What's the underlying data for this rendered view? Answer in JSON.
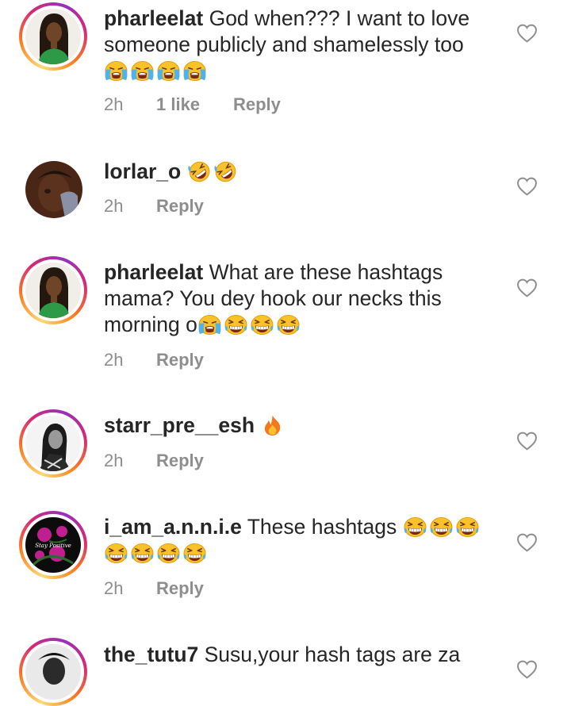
{
  "comments": [
    {
      "username": "pharleelat",
      "text": "God when??? I want to love someone publicly and shamelessly too",
      "emojis": [
        "loudly-crying-face-emoji",
        "loudly-crying-face-emoji",
        "loudly-crying-face-emoji",
        "loudly-crying-face-emoji"
      ],
      "time": "2h",
      "likes": "1 like",
      "reply_label": "Reply"
    },
    {
      "username": "lorlar_o",
      "text": "",
      "emojis": [
        "rolling-on-floor-laughing-emoji",
        "rolling-on-floor-laughing-emoji"
      ],
      "time": "2h",
      "reply_label": "Reply"
    },
    {
      "username": "pharleelat",
      "text": "What are these hashtags mama? You dey hook our necks this morning o",
      "emojis": [
        "loudly-crying-face-emoji",
        "grinning-squinting-face-emoji",
        "grinning-squinting-face-emoji",
        "grinning-squinting-face-emoji"
      ],
      "time": "2h",
      "reply_label": "Reply"
    },
    {
      "username": "starr_pre__esh",
      "text": "",
      "emojis": [
        "fire-emoji"
      ],
      "time": "2h",
      "reply_label": "Reply"
    },
    {
      "username": "i_am_a.n.n.i.e",
      "text": "These hashtags",
      "emojis": [
        "grinning-squinting-face-emoji",
        "grinning-squinting-face-emoji",
        "grinning-squinting-face-emoji",
        "grinning-squinting-face-emoji",
        "grinning-squinting-face-emoji",
        "grinning-squinting-face-emoji",
        "grinning-squinting-face-emoji"
      ],
      "time": "2h",
      "reply_label": "Reply"
    },
    {
      "username": "the_tutu7",
      "text": "Susu,your hash tags are za",
      "emojis": []
    }
  ],
  "avatar_art": {
    "pharleelat_shirt": "#2e9a48",
    "lorlar_o_background": "#4a2616",
    "i_am_annie_flowers": "#c0208f",
    "i_am_annie_overlay": "Stay Positive"
  },
  "colors": {
    "text": "#262626",
    "meta": "#8e8e8e",
    "heart_outline": "#8e8e8e"
  }
}
